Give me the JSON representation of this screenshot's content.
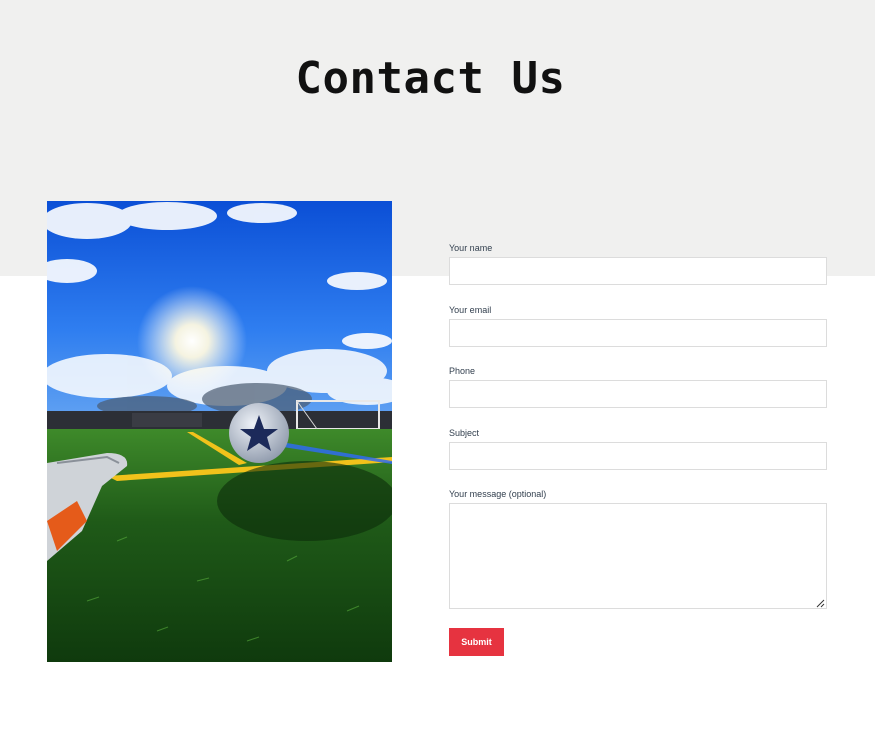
{
  "header": {
    "title": "Contact Us"
  },
  "form": {
    "fields": [
      {
        "label": "Your name",
        "value": ""
      },
      {
        "label": "Your email",
        "value": ""
      },
      {
        "label": "Phone",
        "value": ""
      },
      {
        "label": "Subject",
        "value": ""
      }
    ],
    "message": {
      "label": "Your message (optional)",
      "value": ""
    },
    "submit_label": "Submit"
  },
  "colors": {
    "hero_background": "#f0f0ef",
    "submit_button": "#e63340",
    "label_text": "#33404f",
    "input_border": "#dcdcdc"
  }
}
